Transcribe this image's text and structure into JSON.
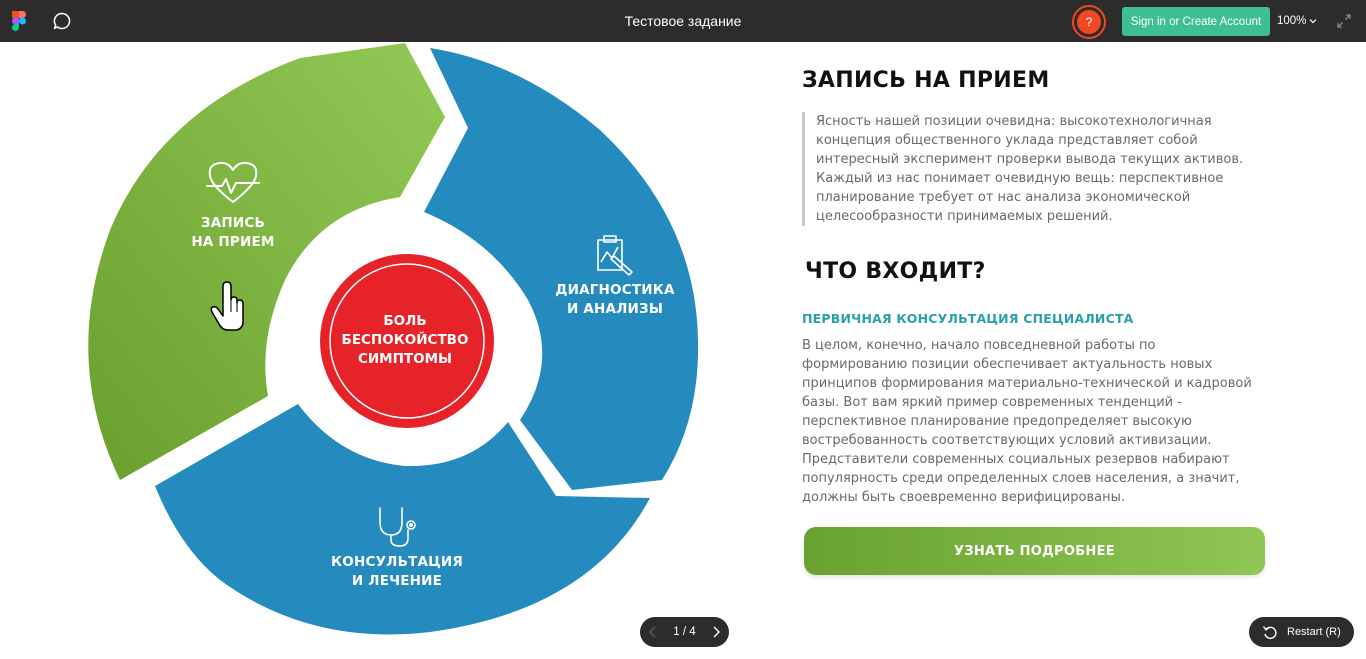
{
  "toolbar": {
    "title": "Тестовое задание",
    "help_label": "?",
    "signin_label": "Sign in or Create Account",
    "zoom": "100%",
    "icons": [
      "figma-logo-icon",
      "comment-icon",
      "chevron-down-icon",
      "expand-icon"
    ]
  },
  "diagram": {
    "segments": [
      {
        "label_line1": "ЗАПИСЬ",
        "label_line2": "НА ПРИЕМ",
        "color": "#7cb342",
        "icon": "heart-pulse-icon"
      },
      {
        "label_line1": "ДИАГНОСТИКА",
        "label_line2": "И АНАЛИЗЫ",
        "color": "#258bbf",
        "icon": "clipboard-chart-icon"
      },
      {
        "label_line1": "КОНСУЛЬТАЦИЯ",
        "label_line2": "И ЛЕЧЕНИЕ",
        "color": "#258bbf",
        "icon": "stethoscope-icon"
      }
    ],
    "center": {
      "line1": "БОЛЬ",
      "line2": "БЕСПОКОЙСТВО",
      "line3": "СИМПТОМЫ",
      "color": "#e52329"
    },
    "cursor_icon": "hand-pointer-icon"
  },
  "content": {
    "heading": "ЗАПИСЬ НА ПРИЕМ",
    "quote_lines": [
      "Ясность нашей позиции очевидна: высокотехнологичная",
      "концепция общественного уклада представляет собой",
      "интересный эксперимент проверки вывода текущих активов.",
      "Каждый из нас понимает очевидную вещь: перспективное",
      "планирование требует от нас анализа экономической",
      "целесообразности принимаемых решений."
    ],
    "heading2": "ЧТО ВХОДИТ?",
    "subheading": "ПЕРВИЧНАЯ КОНСУЛЬТАЦИЯ СПЕЦИАЛИСТА",
    "body_lines": [
      "В целом, конечно, начало повседневной работы по",
      "формированию позиции обеспечивает актуальность новых",
      "принципов формирования материально-технической и кадровой",
      "базы. Вот вам яркий пример современных тенденций -",
      "перспективное планирование предопределяет высокую",
      "востребованность соответствующих условий активизации.",
      "Представители современных социальных резервов набирают",
      "популярность среди определенных слоев населения, а значит,",
      "должны быть своевременно верифицированы."
    ],
    "cta_label": "УЗНАТЬ ПОДРОБНЕЕ"
  },
  "pager": {
    "text": "1 / 4"
  },
  "restart": {
    "label": "Restart (R)"
  }
}
